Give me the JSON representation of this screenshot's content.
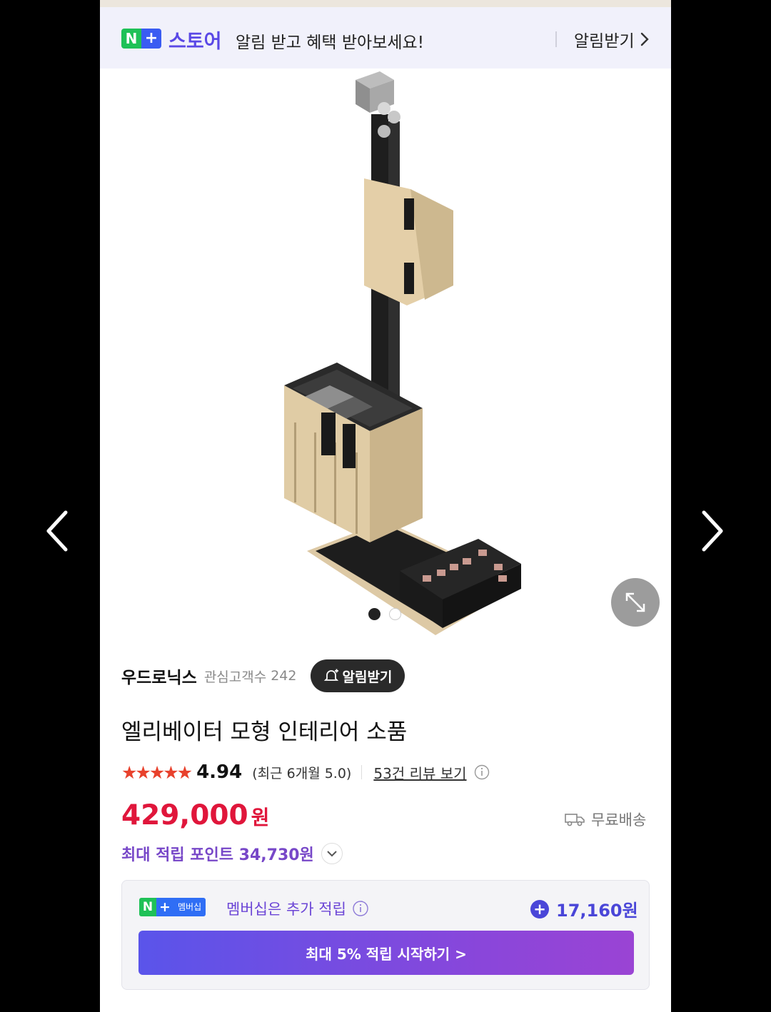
{
  "banner": {
    "logo_n": "N",
    "logo_plus": "+",
    "store_label": "스토어",
    "message": "알림 받고 혜택 받아보세요!",
    "link_label": "알림받기"
  },
  "gallery": {
    "image_alt": "엘리베이터 모형 제품 이미지",
    "current_page": 1,
    "total_pages": 2
  },
  "seller": {
    "name": "우드로닉스",
    "follower_label": "관심고객수",
    "follower_count": "242",
    "notify_label": "알림받기"
  },
  "product": {
    "title": "엘리베이터 모형 인테리어 소품",
    "stars": "★★★★★",
    "rating": "4.94",
    "recent_rating": "(최근 6개월 5.0)",
    "review_link": "53건 리뷰 보기",
    "price": "429,000",
    "currency": "원",
    "shipping": "무료배송",
    "points": "최대 적립 포인트 34,730원"
  },
  "membership": {
    "badge_n": "N",
    "badge_plus": "+",
    "badge_label": "멤버십",
    "text": "멤버십은 추가 적립",
    "bonus_amount": "17,160원",
    "cta_label": "최대 5% 적립 시작하기 >"
  },
  "colors": {
    "price_red": "#e0163b",
    "points_purple": "#7747c8",
    "naver_green": "#1fc157",
    "naver_blue": "#3a5cf2",
    "star_red": "#e8412c"
  }
}
